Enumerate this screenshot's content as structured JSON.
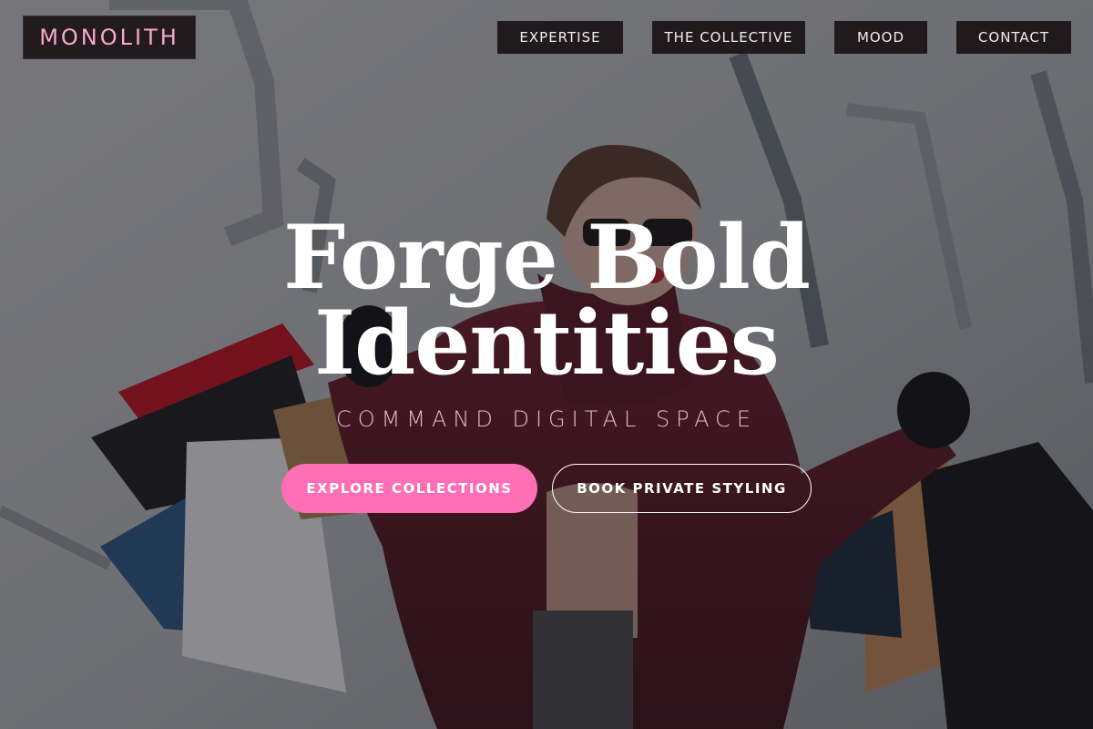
{
  "brand": {
    "logo_text": "MONOLITH"
  },
  "nav": {
    "items": [
      {
        "label": "EXPERTISE"
      },
      {
        "label": "THE COLLECTIVE"
      },
      {
        "label": "MOOD"
      },
      {
        "label": "CONTACT"
      }
    ]
  },
  "hero": {
    "headline_line1": "Forge Bold",
    "headline_line2": "Identities",
    "tagline": "COMMAND DIGITAL SPACE",
    "primary_cta": "EXPLORE COLLECTIONS",
    "secondary_cta": "BOOK PRIVATE STYLING",
    "image": "woman-with-shopping-bags-photo"
  },
  "colors": {
    "accent": "#ff6fb5",
    "logo_text": "#f6a9c8",
    "tagline": "#f0b7cd",
    "nav_bg": "#201a1d",
    "coat": "#5a1a26"
  }
}
